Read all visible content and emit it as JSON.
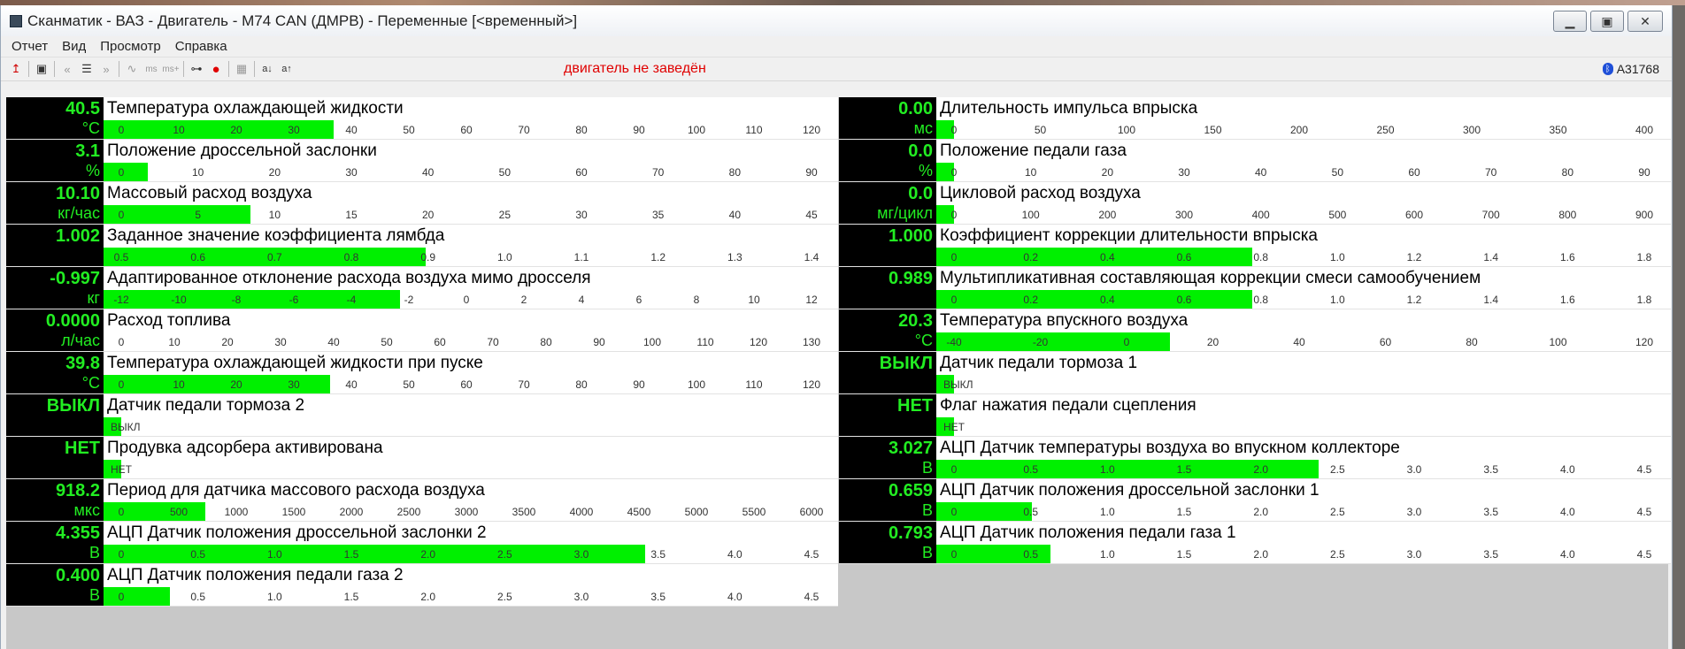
{
  "window": {
    "title": "Сканматик - ВАЗ - Двигатель - М74 CAN (ДМРВ) - Переменные [<временный>]",
    "controls": {
      "minimize": "▁",
      "maximize": "▣",
      "close": "✕"
    }
  },
  "menu": {
    "items": [
      "Отчет",
      "Вид",
      "Просмотр",
      "Справка"
    ]
  },
  "toolbar": {
    "buttons": [
      "↥",
      "▣",
      "«",
      "☰",
      "»",
      "∿",
      "ms",
      "ms+",
      "⊶",
      "●",
      "▦",
      "a↓",
      "a↑"
    ],
    "status_message": "двигатель не заведён",
    "device_id": "A31768",
    "bt_glyph": "ᛒ"
  },
  "colors": {
    "value_green": "#22ee22",
    "bar_green": "#00f000",
    "record_red": "#e00000",
    "status_red": "#e00000",
    "bluetooth_blue": "#1e4fd8"
  },
  "params_left": [
    {
      "value": "40.5",
      "unit": "°C",
      "label": "Температура охлаждающей жидкости",
      "ticks": [
        "0",
        "10",
        "20",
        "30",
        "40",
        "50",
        "60",
        "70",
        "80",
        "90",
        "100",
        "110",
        "120"
      ],
      "fill": 0.313
    },
    {
      "value": "3.1",
      "unit": "%",
      "label": "Положение дроссельной заслонки",
      "ticks": [
        "0",
        "10",
        "20",
        "30",
        "40",
        "50",
        "60",
        "70",
        "80",
        "90"
      ],
      "fill": 0.06
    },
    {
      "value": "10.10",
      "unit": "кг/час",
      "label": "Массовый расход воздуха",
      "ticks": [
        "0",
        "5",
        "10",
        "15",
        "20",
        "25",
        "30",
        "35",
        "40",
        "45"
      ],
      "fill": 0.2
    },
    {
      "value": "1.002",
      "unit": "",
      "label": "Заданное значение коэффициента лямбда",
      "ticks": [
        "0.5",
        "0.6",
        "0.7",
        "0.8",
        "0.9",
        "1.0",
        "1.1",
        "1.2",
        "1.3",
        "1.4"
      ],
      "fill": 0.439
    },
    {
      "value": "-0.997",
      "unit": "кг",
      "label": "Адаптированное отклонение расхода воздуха мимо дросселя",
      "ticks": [
        "-12",
        "-10",
        "-8",
        "-6",
        "-4",
        "-2",
        "0",
        "2",
        "4",
        "6",
        "8",
        "10",
        "12"
      ],
      "fill": 0.404
    },
    {
      "value": "0.0000",
      "unit": "л/час",
      "label": "Расход топлива",
      "ticks": [
        "0",
        "10",
        "20",
        "30",
        "40",
        "50",
        "60",
        "70",
        "80",
        "90",
        "100",
        "110",
        "120",
        "130"
      ],
      "fill": 0.0
    },
    {
      "value": "39.8",
      "unit": "°C",
      "label": "Температура охлаждающей жидкости при пуске",
      "ticks": [
        "0",
        "10",
        "20",
        "30",
        "40",
        "50",
        "60",
        "70",
        "80",
        "90",
        "100",
        "110",
        "120"
      ],
      "fill": 0.308
    },
    {
      "value": "ВЫКЛ",
      "unit": "",
      "label": "Датчик педали тормоза 2",
      "ticks": [
        "ВЫКЛ"
      ],
      "fill": 0.024
    },
    {
      "value": "НЕТ",
      "unit": "",
      "label": "Продувка адсорбера активирована",
      "ticks": [
        "НЕТ"
      ],
      "fill": 0.024
    },
    {
      "value": "918.2",
      "unit": "мкс",
      "label": "Период для датчика массового расхода воздуха",
      "ticks": [
        "0",
        "500",
        "1000",
        "1500",
        "2000",
        "2500",
        "3000",
        "3500",
        "4000",
        "4500",
        "5000",
        "5500",
        "6000"
      ],
      "fill": 0.138
    },
    {
      "value": "4.355",
      "unit": "В",
      "label": "АЦП Датчик положения дроссельной заслонки 2",
      "ticks": [
        "0",
        "0.5",
        "1.0",
        "1.5",
        "2.0",
        "2.5",
        "3.0",
        "3.5",
        "4.0",
        "4.5"
      ],
      "fill": 0.737
    },
    {
      "value": "0.400",
      "unit": "В",
      "label": "АЦП Датчик положения педали газа 2",
      "ticks": [
        "0",
        "0.5",
        "1.0",
        "1.5",
        "2.0",
        "2.5",
        "3.0",
        "3.5",
        "4.0",
        "4.5"
      ],
      "fill": 0.09
    }
  ],
  "params_right": [
    {
      "value": "0.00",
      "unit": "мс",
      "label": "Длительность импульса впрыска",
      "ticks": [
        "0",
        "50",
        "100",
        "150",
        "200",
        "250",
        "300",
        "350",
        "400"
      ],
      "fill": 0.024
    },
    {
      "value": "0.0",
      "unit": "%",
      "label": "Положение педали газа",
      "ticks": [
        "0",
        "10",
        "20",
        "30",
        "40",
        "50",
        "60",
        "70",
        "80",
        "90"
      ],
      "fill": 0.024
    },
    {
      "value": "0.0",
      "unit": "мг/цикл",
      "label": "Цикловой расход воздуха",
      "ticks": [
        "0",
        "100",
        "200",
        "300",
        "400",
        "500",
        "600",
        "700",
        "800",
        "900"
      ],
      "fill": 0.024
    },
    {
      "value": "1.000",
      "unit": "",
      "label": "Коэффициент коррекции длительности впрыска",
      "ticks": [
        "0",
        "0.2",
        "0.4",
        "0.6",
        "0.8",
        "1.0",
        "1.2",
        "1.4",
        "1.6",
        "1.8"
      ],
      "fill": 0.43
    },
    {
      "value": "0.989",
      "unit": "",
      "label": "Мультипликативная составляющая коррекции смеси самообучением",
      "ticks": [
        "0",
        "0.2",
        "0.4",
        "0.6",
        "0.8",
        "1.0",
        "1.2",
        "1.4",
        "1.6",
        "1.8"
      ],
      "fill": 0.43
    },
    {
      "value": "20.3",
      "unit": "°C",
      "label": "Температура впускного воздуха",
      "ticks": [
        "-40",
        "-20",
        "0",
        "20",
        "40",
        "60",
        "80",
        "100",
        "120"
      ],
      "fill": 0.318
    },
    {
      "value": "ВЫКЛ",
      "unit": "",
      "label": "Датчик педали тормоза 1",
      "ticks": [
        "ВЫКЛ"
      ],
      "fill": 0.024
    },
    {
      "value": "НЕТ",
      "unit": "",
      "label": "Флаг нажатия педали сцепления",
      "ticks": [
        "НЕТ"
      ],
      "fill": 0.024
    },
    {
      "value": "3.027",
      "unit": "В",
      "label": "АЦП Датчик температуры воздуха во впускном коллекторе",
      "ticks": [
        "0",
        "0.5",
        "1.0",
        "1.5",
        "2.0",
        "2.5",
        "3.0",
        "3.5",
        "4.0",
        "4.5"
      ],
      "fill": 0.52
    },
    {
      "value": "0.659",
      "unit": "В",
      "label": "АЦП Датчик положения дроссельной заслонки 1",
      "ticks": [
        "0",
        "0.5",
        "1.0",
        "1.5",
        "2.0",
        "2.5",
        "3.0",
        "3.5",
        "4.0",
        "4.5"
      ],
      "fill": 0.13
    },
    {
      "value": "0.793",
      "unit": "В",
      "label": "АЦП Датчик положения педали газа 1",
      "ticks": [
        "0",
        "0.5",
        "1.0",
        "1.5",
        "2.0",
        "2.5",
        "3.0",
        "3.5",
        "4.0",
        "4.5"
      ],
      "fill": 0.155
    }
  ]
}
